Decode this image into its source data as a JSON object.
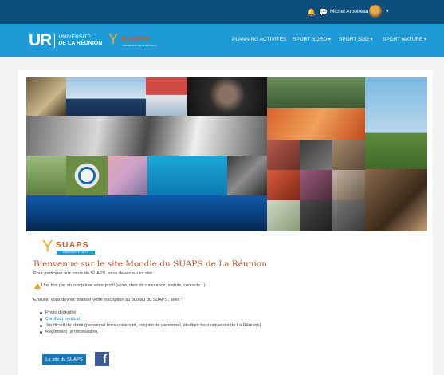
{
  "user_bar": {
    "user_name": "Michel Arboireau",
    "icons": [
      "bell-icon",
      "chat-icon",
      "chevron-down-icon"
    ]
  },
  "brand": {
    "university_mark": "UR",
    "university_line1": "UNIVERSITÉ",
    "university_line2": "DE LA RÉUNION",
    "suaps_word": "SUAPS",
    "suaps_sub": "UNIVERSITÉ DE LA RÉUNION"
  },
  "nav": {
    "items": [
      {
        "label": "PLANNING ACTIVITÉS"
      },
      {
        "label": "SPORT NORD ▾"
      },
      {
        "label": "SPORT SUD ▾"
      },
      {
        "label": "SPORT NATURE ▾"
      }
    ]
  },
  "colors": {
    "top_bar": "#0d4f7c",
    "nav_bar": "#1e9ad6",
    "title": "#c9502a",
    "link": "#1e88c7",
    "button": "#1b76b6",
    "facebook": "#3b5998"
  },
  "welcome": {
    "logo_word": "SUAPS",
    "logo_sub": "UNIVERSITÉ DE LA RÉUNION",
    "title": "Bienvenue sur le site Moodle du SUAPS de La Réunion",
    "intro": "Pour participer aux cours du SUAPS, vous devez sur ce site :",
    "warning": "Une fois par an compléter votre profil (sexe, date de naissance, statuts, contacts...)",
    "then": "Ensuite, vous devrez finaliser votre inscription au bureau du SUAPS, avec :",
    "items": [
      {
        "label": "Photo d'identité",
        "link": false
      },
      {
        "label": "Certificat médical",
        "link": true
      },
      {
        "label": "Justificatif de statut (personnel hors université, conjoint de personnel, étudiant hors université de La Réunion)",
        "link": false
      },
      {
        "label": "Règlement (si nécessaire).",
        "link": false
      }
    ],
    "site_button": "Le site du SUAPS",
    "facebook_glyph": "f"
  }
}
